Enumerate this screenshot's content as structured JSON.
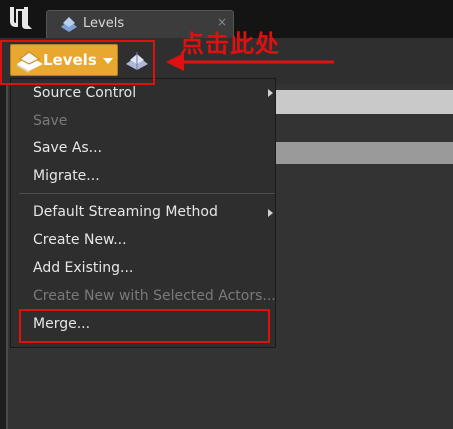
{
  "app": {
    "logo_icon": "unreal-engine-logo-icon"
  },
  "tab": {
    "label": "Levels",
    "icon": "levels-icon",
    "close_icon": "close-icon"
  },
  "toolbar": {
    "levels_button_label": "Levels",
    "levels_icon": "levels-icon",
    "caret_icon": "chevron-down-icon",
    "extra_icon": "levels-details-icon"
  },
  "annotation": {
    "text": "点击此处",
    "color": "#e01010"
  },
  "menu": {
    "items": [
      {
        "label": "Source Control",
        "enabled": true,
        "submenu": true
      },
      {
        "label": "Save",
        "enabled": false
      },
      {
        "label": "Save As...",
        "enabled": true
      },
      {
        "label": "Migrate...",
        "enabled": true
      },
      {
        "label": "Default Streaming Method",
        "enabled": true,
        "submenu": true
      },
      {
        "label": "Create New...",
        "enabled": true
      },
      {
        "label": "Add Existing...",
        "enabled": true
      },
      {
        "label": "Create New with Selected Actors...",
        "enabled": false
      },
      {
        "label": "Merge...",
        "enabled": true
      }
    ]
  },
  "colors": {
    "accent": "#e8a72f",
    "highlight": "#e01010"
  }
}
